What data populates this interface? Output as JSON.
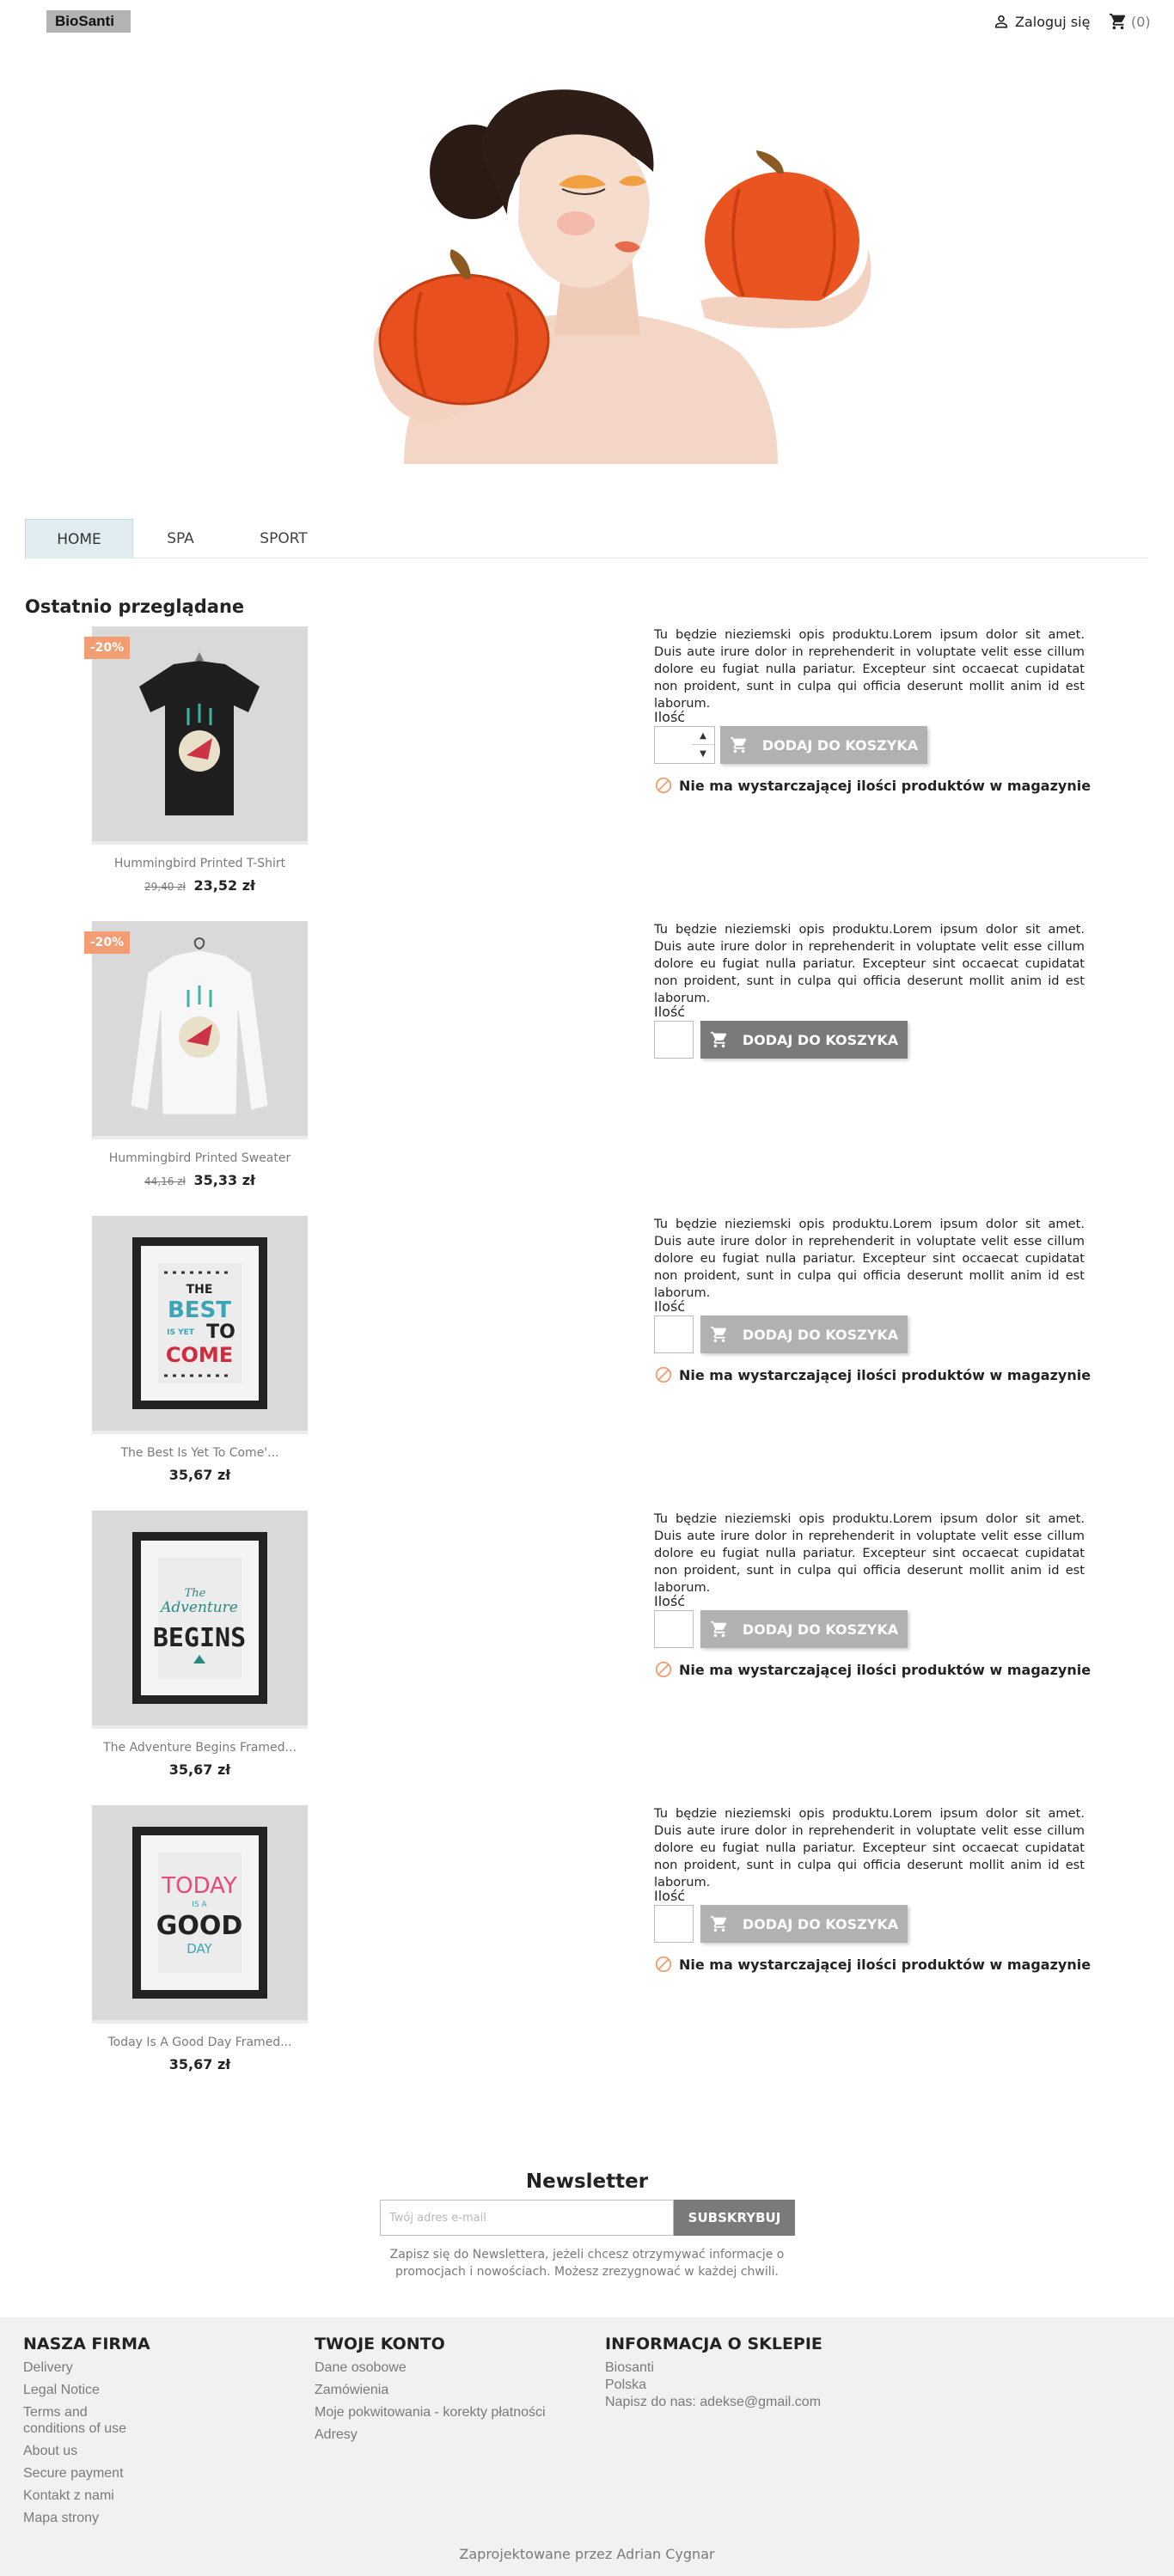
{
  "header": {
    "logo": "BioSanti",
    "login_label": "Zaloguj się",
    "cart_count": "(0)"
  },
  "tabs": [
    {
      "label": "HOME",
      "active": true
    },
    {
      "label": "SPA",
      "active": false
    },
    {
      "label": "SPORT",
      "active": false
    }
  ],
  "recent": {
    "title": "Ostatnio przeglądane",
    "qty_label": "Ilość",
    "add_label": "DODAJ DO KOSZYKA",
    "stock_label": "Nie ma wystarczającej ilości produktów w magazynie",
    "products": [
      {
        "name": "Hummingbird Printed T-Shirt",
        "discount": "-20%",
        "old_price": "29,40 zł",
        "price": "23,52 zł",
        "description": "Tu będzie nieziemski opis produktu.Lorem ipsum dolor sit amet. Duis aute irure dolor in reprehenderit in voluptate velit esse cillum dolore eu fugiat nulla pariatur. Excepteur sint occaecat cupidatat non proident, sunt in culpa qui officia deserunt mollit anim id est laborum.",
        "image": "tshirt"
      },
      {
        "name": "Hummingbird Printed Sweater",
        "discount": "-20%",
        "old_price": "44,16 zł",
        "price": "35,33 zł",
        "description": "Tu będzie nieziemski opis produktu.Lorem ipsum dolor sit amet. Duis aute irure dolor in reprehenderit in voluptate velit esse cillum dolore eu fugiat nulla pariatur. Excepteur sint occaecat cupidatat non proident, sunt in culpa qui officia deserunt mollit anim id est laborum.",
        "image": "sweater"
      },
      {
        "name": "The Best Is Yet To Come'...",
        "discount": "",
        "old_price": "",
        "price": "35,67 zł",
        "description": "Tu będzie nieziemski opis produktu.Lorem ipsum dolor sit amet. Duis aute irure dolor in reprehenderit in voluptate velit esse cillum dolore eu fugiat nulla pariatur. Excepteur sint occaecat cupidatat non proident, sunt in culpa qui officia deserunt mollit anim id est laborum.",
        "image": "poster-best",
        "poster_lines": [
          "THE",
          "BEST",
          "IS YET",
          "TO",
          "COME"
        ]
      },
      {
        "name": "The Adventure Begins Framed...",
        "discount": "",
        "old_price": "",
        "price": "35,67 zł",
        "description": "Tu będzie nieziemski opis produktu.Lorem ipsum dolor sit amet. Duis aute irure dolor in reprehenderit in voluptate velit esse cillum dolore eu fugiat nulla pariatur. Excepteur sint occaecat cupidatat non proident, sunt in culpa qui officia deserunt mollit anim id est laborum.",
        "image": "poster-adventure",
        "poster_lines": [
          "The",
          "Adventure",
          "BEGINS"
        ]
      },
      {
        "name": "Today Is A Good Day Framed...",
        "discount": "",
        "old_price": "",
        "price": "35,67 zł",
        "description": "Tu będzie nieziemski opis produktu.Lorem ipsum dolor sit amet. Duis aute irure dolor in reprehenderit in voluptate velit esse cillum dolore eu fugiat nulla pariatur. Excepteur sint occaecat cupidatat non proident, sunt in culpa qui officia deserunt mollit anim id est laborum.",
        "image": "poster-today",
        "poster_lines": [
          "TODAY",
          "IS A",
          "GOOD",
          "DAY"
        ]
      }
    ]
  },
  "newsletter": {
    "title": "Newsletter",
    "placeholder": "Twój adres e-mail",
    "button": "SUBSKRYBUJ",
    "info": "Zapisz się do Newslettera, jeżeli chcesz otrzymywać informacje o promocjach i nowościach. Możesz zrezygnować w każdej chwili."
  },
  "footer": {
    "company": {
      "title": "NASZA FIRMA",
      "links": [
        "Delivery",
        "Legal Notice",
        "Terms and conditions of use",
        "About us",
        "Secure payment",
        "Kontakt z nami",
        "Mapa strony"
      ]
    },
    "account": {
      "title": "TWOJE KONTO",
      "links": [
        "Dane osobowe",
        "Zamówienia",
        "Moje pokwitowania - korekty płatności",
        "Adresy"
      ]
    },
    "store": {
      "title": "INFORMACJA O SKLEPIE",
      "name": "Biosanti",
      "country": "Polska",
      "contact": "Napisz do nas: adekse@gmail.com"
    },
    "credits": "Zaprojektowane przez Adrian Cygnar"
  },
  "colors": {
    "discount_badge": "#f39d72",
    "tab_active_bg": "#e0ecef",
    "button_disabled": "#b1b1b1",
    "button_enabled": "#7a7a7a",
    "footer_bg": "#f1f1f1",
    "stock_icon": "#f39d72"
  }
}
